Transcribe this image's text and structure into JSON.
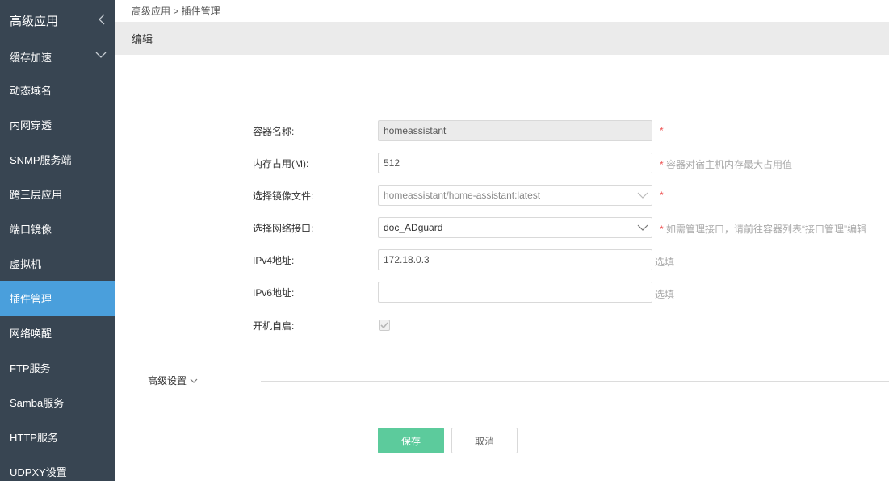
{
  "sidebar": {
    "header": "高级应用",
    "items": [
      {
        "label": "缓存加速",
        "has_chevron": true
      },
      {
        "label": "动态域名"
      },
      {
        "label": "内网穿透"
      },
      {
        "label": "SNMP服务端"
      },
      {
        "label": "跨三层应用"
      },
      {
        "label": "端口镜像"
      },
      {
        "label": "虚拟机"
      },
      {
        "label": "插件管理",
        "active": true
      },
      {
        "label": "网络唤醒"
      },
      {
        "label": "FTP服务"
      },
      {
        "label": "Samba服务"
      },
      {
        "label": "HTTP服务"
      },
      {
        "label": "UDPXY设置"
      }
    ],
    "active_color": "#4a9fdc",
    "bg_color": "#384552"
  },
  "breadcrumb": "高级应用 > 插件管理",
  "panel_title": "编辑",
  "form": {
    "container_name": {
      "label": "容器名称:",
      "value": "homeassistant",
      "required": "*"
    },
    "memory": {
      "label": "内存占用(M):",
      "value": "512",
      "required": "*",
      "hint": "容器对宿主机内存最大占用值"
    },
    "image": {
      "label": "选择镜像文件:",
      "value": "homeassistant/home-assistant:latest",
      "required": "*"
    },
    "network": {
      "label": "选择网络接口:",
      "value": "doc_ADguard",
      "required": "*",
      "hint": "如需管理接口，请前往容器列表“接口管理”编辑"
    },
    "ipv4": {
      "label": "IPv4地址:",
      "value": "172.18.0.3",
      "optional": "选填"
    },
    "ipv6": {
      "label": "IPv6地址:",
      "value": "",
      "optional": "选填"
    },
    "autostart": {
      "label": "开机自启:",
      "checked": true
    }
  },
  "advanced": {
    "label": "高级设置"
  },
  "buttons": {
    "save": "保存",
    "cancel": "取消",
    "save_color": "#5ccb9c"
  }
}
